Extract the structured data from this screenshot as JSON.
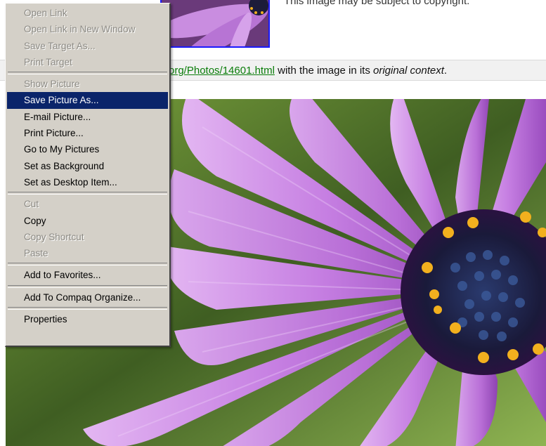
{
  "page": {
    "copyright_note": "This image may be subject to copyright.",
    "context_link": "org/Photos/14601.html",
    "context_text_1": " with the image in its ",
    "context_italic": "original context",
    "context_text_2": "."
  },
  "menu": {
    "groups": [
      [
        {
          "label": "Open Link",
          "enabled": false
        },
        {
          "label": "Open Link in New Window",
          "enabled": false
        },
        {
          "label": "Save Target As...",
          "enabled": false
        },
        {
          "label": "Print Target",
          "enabled": false
        }
      ],
      [
        {
          "label": "Show Picture",
          "enabled": false
        },
        {
          "label": "Save Picture As...",
          "enabled": true,
          "highlighted": true
        },
        {
          "label": "E-mail Picture...",
          "enabled": true
        },
        {
          "label": "Print Picture...",
          "enabled": true
        },
        {
          "label": "Go to My Pictures",
          "enabled": true
        },
        {
          "label": "Set as Background",
          "enabled": true
        },
        {
          "label": "Set as Desktop Item...",
          "enabled": true
        }
      ],
      [
        {
          "label": "Cut",
          "enabled": false
        },
        {
          "label": "Copy",
          "enabled": true
        },
        {
          "label": "Copy Shortcut",
          "enabled": false
        },
        {
          "label": "Paste",
          "enabled": false
        }
      ],
      [
        {
          "label": "Add to Favorites...",
          "enabled": true
        }
      ],
      [
        {
          "label": "Add To Compaq Organize...",
          "enabled": true
        }
      ],
      [
        {
          "label": "Properties",
          "enabled": true
        }
      ]
    ]
  },
  "colors": {
    "menu_bg": "#d4d0c8",
    "highlight": "#0a246a",
    "link": "#0a7d0a",
    "petal": "#c77fe0",
    "flower_center": "#1c1c3a",
    "pollen": "#f2b01e"
  }
}
